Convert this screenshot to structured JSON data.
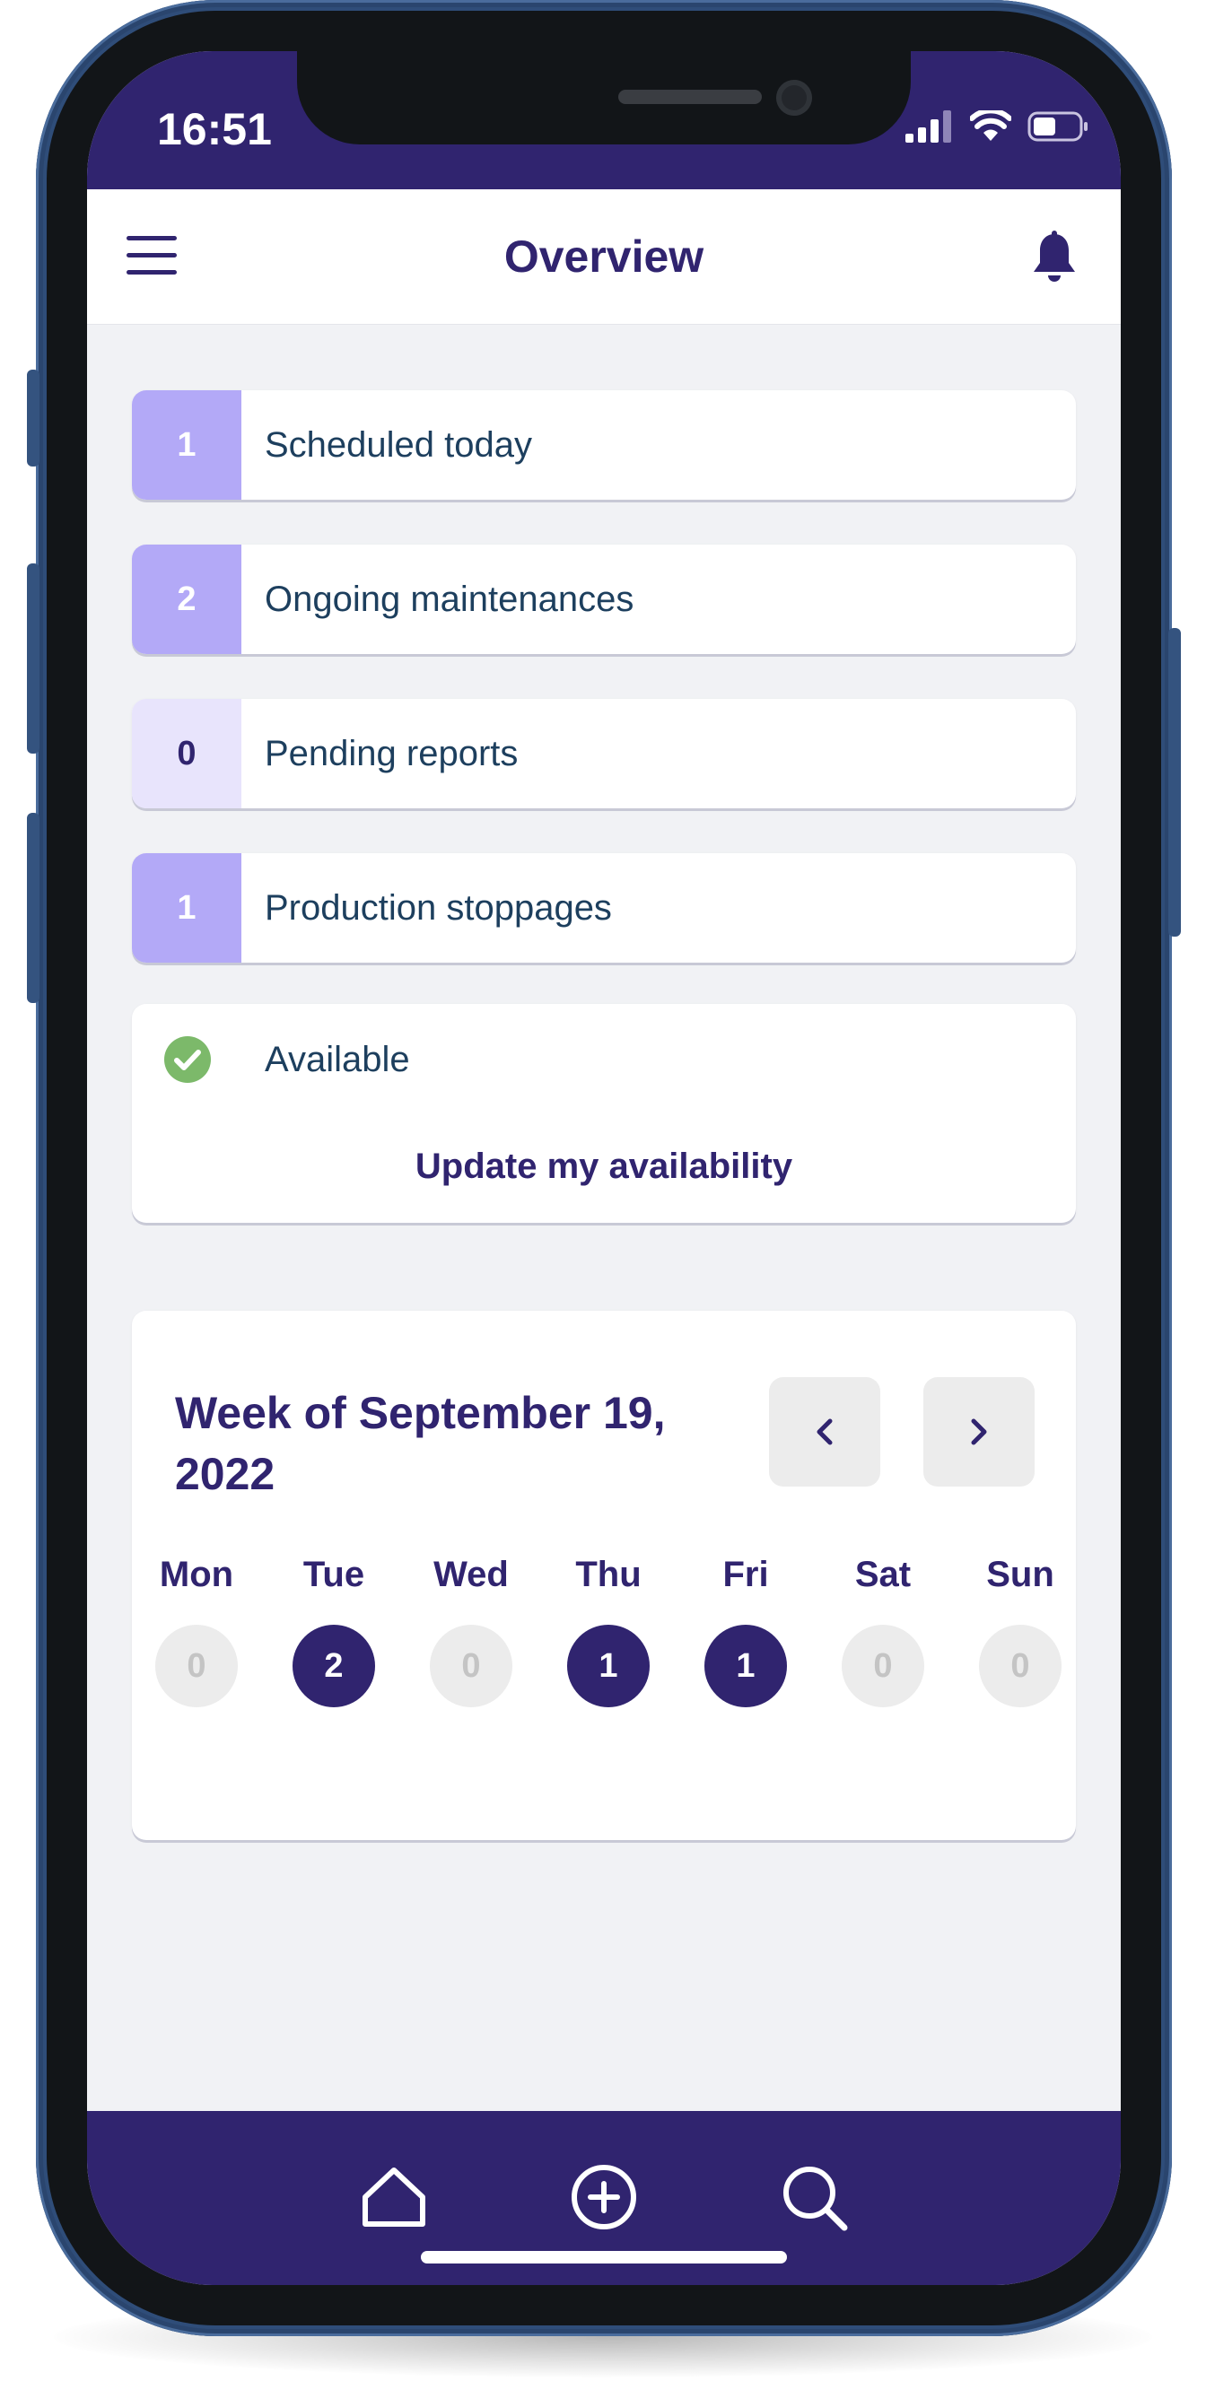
{
  "status_bar": {
    "time": "16:51"
  },
  "header": {
    "title": "Overview"
  },
  "stats": [
    {
      "count": "1",
      "label": "Scheduled today"
    },
    {
      "count": "2",
      "label": "Ongoing maintenances"
    },
    {
      "count": "0",
      "label": "Pending reports"
    },
    {
      "count": "1",
      "label": "Production stoppages"
    }
  ],
  "availability": {
    "status": "Available",
    "update_label": "Update my availability"
  },
  "week": {
    "title": "Week of September 19, 2022",
    "days": [
      {
        "name": "Mon",
        "count": "0"
      },
      {
        "name": "Tue",
        "count": "2"
      },
      {
        "name": "Wed",
        "count": "0"
      },
      {
        "name": "Thu",
        "count": "1"
      },
      {
        "name": "Fri",
        "count": "1"
      },
      {
        "name": "Sat",
        "count": "0"
      },
      {
        "name": "Sun",
        "count": "0"
      }
    ]
  },
  "tabbar": {
    "icons": [
      "home-icon",
      "add-circle-icon",
      "search-icon"
    ]
  },
  "colors": {
    "primary": "#30246f",
    "badge": "#b3a9f7",
    "badge_zero": "#e8e4fc",
    "available": "#7cb96a",
    "background": "#f1f2f5"
  }
}
